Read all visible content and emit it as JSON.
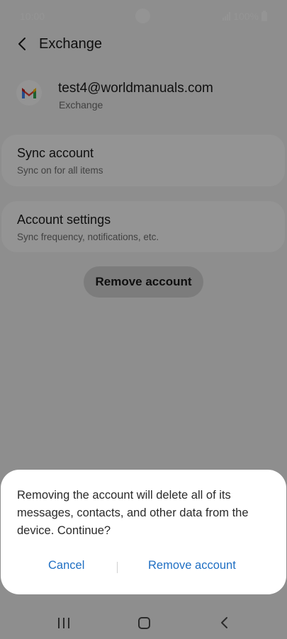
{
  "status_bar": {
    "time": "10:00",
    "battery": "100%"
  },
  "app_bar": {
    "title": "Exchange",
    "back_icon": "back-chevron-icon"
  },
  "account": {
    "email": "test4@worldmanuals.com",
    "type": "Exchange",
    "logo_icon": "gmail-logo-icon"
  },
  "items": [
    {
      "title": "Sync account",
      "subtitle": "Sync on for all items"
    },
    {
      "title": "Account settings",
      "subtitle": "Sync frequency, notifications, etc."
    }
  ],
  "remove_button": "Remove account",
  "dialog": {
    "message": "Removing the account will delete all of its messages, contacts, and other data from the device. Continue?",
    "cancel": "Cancel",
    "confirm": "Remove account"
  },
  "colors": {
    "accent": "#1f6fc3",
    "scrim": "rgba(0,0,0,0.42)"
  }
}
